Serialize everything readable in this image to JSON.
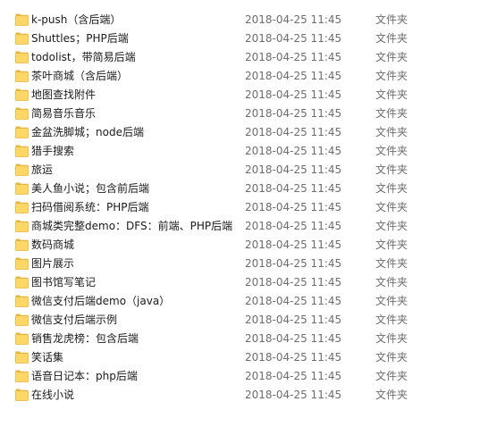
{
  "folder_icon_color": "#ffd766",
  "folder_icon_dark": "#e6b53e",
  "files": [
    {
      "name": "k-push（含后端）",
      "date": "2018-04-25 11:45",
      "type": "文件夹"
    },
    {
      "name": "Shuttles；PHP后端",
      "date": "2018-04-25 11:45",
      "type": "文件夹"
    },
    {
      "name": "todolist，带简易后端",
      "date": "2018-04-25 11:45",
      "type": "文件夹"
    },
    {
      "name": "茶叶商城（含后端）",
      "date": "2018-04-25 11:45",
      "type": "文件夹"
    },
    {
      "name": "地图查找附件",
      "date": "2018-04-25 11:45",
      "type": "文件夹"
    },
    {
      "name": "简易音乐音乐",
      "date": "2018-04-25 11:45",
      "type": "文件夹"
    },
    {
      "name": "金盆洗脚城；node后端",
      "date": "2018-04-25 11:45",
      "type": "文件夹"
    },
    {
      "name": "猎手搜索",
      "date": "2018-04-25 11:45",
      "type": "文件夹"
    },
    {
      "name": "旅运",
      "date": "2018-04-25 11:45",
      "type": "文件夹"
    },
    {
      "name": "美人鱼小说；包含前后端",
      "date": "2018-04-25 11:45",
      "type": "文件夹"
    },
    {
      "name": "扫码借阅系统：PHP后端",
      "date": "2018-04-25 11:45",
      "type": "文件夹"
    },
    {
      "name": "商城类完整demo：DFS：前端、PHP后端",
      "date": "2018-04-25 11:45",
      "type": "文件夹"
    },
    {
      "name": "数码商城",
      "date": "2018-04-25 11:45",
      "type": "文件夹"
    },
    {
      "name": "图片展示",
      "date": "2018-04-25 11:45",
      "type": "文件夹"
    },
    {
      "name": "图书馆写笔记",
      "date": "2018-04-25 11:45",
      "type": "文件夹"
    },
    {
      "name": "微信支付后端demo（java）",
      "date": "2018-04-25 11:45",
      "type": "文件夹"
    },
    {
      "name": "微信支付后端示例",
      "date": "2018-04-25 11:45",
      "type": "文件夹"
    },
    {
      "name": "销售龙虎榜：包含后端",
      "date": "2018-04-25 11:45",
      "type": "文件夹"
    },
    {
      "name": "笑话集",
      "date": "2018-04-25 11:45",
      "type": "文件夹"
    },
    {
      "name": "语音日记本：php后端",
      "date": "2018-04-25 11:45",
      "type": "文件夹"
    },
    {
      "name": "在线小说",
      "date": "2018-04-25 11:45",
      "type": "文件夹"
    }
  ]
}
